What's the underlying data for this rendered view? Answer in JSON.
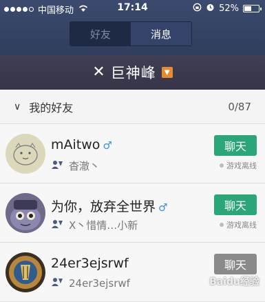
{
  "status_bar": {
    "carrier": "中国移动",
    "time": "17:14",
    "battery": "52%",
    "battery_level": 0.52
  },
  "tabs": [
    {
      "label": "好友",
      "active": true
    },
    {
      "label": "消息",
      "active": false
    }
  ],
  "user": {
    "name": "巨神峰",
    "badge_icon": "down-arrow-badge-icon"
  },
  "group": {
    "title": "我的好友",
    "count": "0/87"
  },
  "friends": [
    {
      "name": "mAitwo",
      "gender_icon": "♂",
      "subtitle": "杳澈丶",
      "chat_label": "聊天",
      "status": "游戏离线",
      "button_color": "#2aa679"
    },
    {
      "name": "为你，放弃全世界",
      "gender_icon": "♂",
      "subtitle": "X丶惜情…小新",
      "chat_label": "聊天",
      "status": "游戏离线",
      "button_color": "#2aa679"
    },
    {
      "name": "24er3ejsrwf",
      "subtitle": "24er3ejsrwf",
      "chat_label": "聊天",
      "button_color": "#8a8a8a"
    }
  ],
  "watermark": "Baidu经验"
}
